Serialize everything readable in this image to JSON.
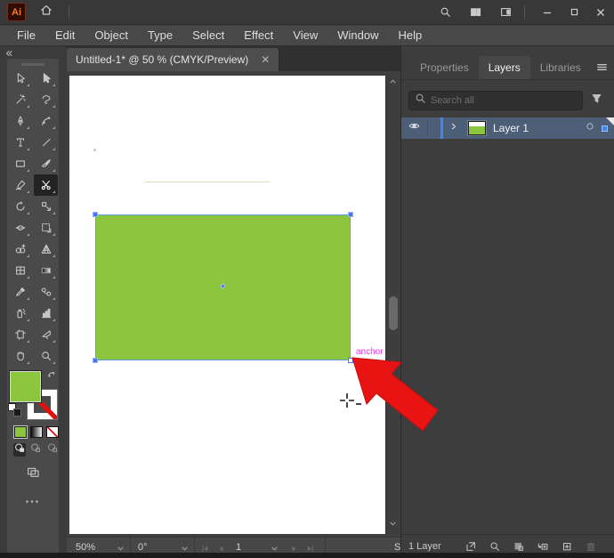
{
  "titlebar": {
    "app_badge": "Ai",
    "right_icons": [
      {
        "name": "search-icon",
        "icon": "search"
      },
      {
        "name": "workspace-switcher-icon",
        "icon": "workspace-grid"
      },
      {
        "name": "arrange-documents-icon",
        "icon": "arrange-doc"
      }
    ],
    "window_controls": [
      {
        "name": "minimize-button",
        "icon": "minimize"
      },
      {
        "name": "maximize-button",
        "icon": "maximize"
      },
      {
        "name": "close-button",
        "icon": "close"
      }
    ]
  },
  "menubar": {
    "items": [
      "File",
      "Edit",
      "Object",
      "Type",
      "Select",
      "Effect",
      "View",
      "Window",
      "Help"
    ]
  },
  "document_tab": {
    "title": "Untitled-1* @ 50 % (CMYK/Preview)",
    "close_glyph": "✕"
  },
  "toolbar": {
    "tools": [
      {
        "name": "selection-tool",
        "icon": "cursor-outline"
      },
      {
        "name": "direct-selection-tool",
        "icon": "cursor-filled"
      },
      {
        "name": "magic-wand-tool",
        "icon": "magic-wand"
      },
      {
        "name": "lasso-tool",
        "icon": "lasso"
      },
      {
        "name": "pen-tool",
        "icon": "pen"
      },
      {
        "name": "curvature-tool",
        "icon": "curvature"
      },
      {
        "name": "type-tool",
        "icon": "type"
      },
      {
        "name": "line-segment-tool",
        "icon": "line"
      },
      {
        "name": "rectangle-tool",
        "icon": "rectangle"
      },
      {
        "name": "paintbrush-tool",
        "icon": "paintbrush"
      },
      {
        "name": "shaper-tool",
        "icon": "shaper"
      },
      {
        "name": "scissors-tool",
        "icon": "scissors",
        "active": true
      },
      {
        "name": "rotate-tool",
        "icon": "rotate"
      },
      {
        "name": "scale-tool",
        "icon": "scale"
      },
      {
        "name": "width-tool",
        "icon": "width"
      },
      {
        "name": "free-transform-tool",
        "icon": "free-transform"
      },
      {
        "name": "shape-builder-tool",
        "icon": "shape-builder"
      },
      {
        "name": "perspective-grid-tool",
        "icon": "perspective-grid"
      },
      {
        "name": "mesh-tool",
        "icon": "mesh"
      },
      {
        "name": "gradient-tool",
        "icon": "gradient"
      },
      {
        "name": "eyedropper-tool",
        "icon": "eyedropper"
      },
      {
        "name": "blend-tool",
        "icon": "blend"
      },
      {
        "name": "symbol-sprayer-tool",
        "icon": "symbol-sprayer"
      },
      {
        "name": "graph-tool",
        "icon": "graph"
      },
      {
        "name": "artboard-tool",
        "icon": "artboard"
      },
      {
        "name": "slice-tool",
        "icon": "slice"
      },
      {
        "name": "hand-tool",
        "icon": "hand"
      },
      {
        "name": "zoom-tool",
        "icon": "zoom"
      }
    ],
    "fill_color": "#8CC63F",
    "more_label": "•••"
  },
  "canvas": {
    "anchor_label": "anchor"
  },
  "statusbar": {
    "zoom_level": "50%",
    "rotation": "0°",
    "artboard_number": "1",
    "tool_hint": "Sc"
  },
  "right_panel": {
    "tabs": [
      {
        "label": "Properties",
        "active": false
      },
      {
        "label": "Layers",
        "active": true
      },
      {
        "label": "Libraries",
        "active": false
      }
    ],
    "search_placeholder": "Search all",
    "layer_row": {
      "name": "Layer 1"
    },
    "footer": {
      "layer_count": "1 Layer",
      "icons": [
        {
          "name": "collect-for-export-icon",
          "icon": "collect-export"
        },
        {
          "name": "locate-object-icon",
          "icon": "locate-object"
        },
        {
          "name": "make-clipping-mask-icon",
          "icon": "clip-mask"
        },
        {
          "name": "create-sublayer-icon",
          "icon": "new-sublayer"
        },
        {
          "name": "create-new-layer-icon",
          "icon": "new-layer"
        },
        {
          "name": "delete-layer-icon",
          "icon": "trash",
          "disabled": true
        }
      ]
    }
  },
  "colors": {
    "rect_fill": "#8CC63F",
    "selection_blue": "#4A74F0",
    "layer_row_blue": "#4D5F77",
    "anchor_magenta": "#E937E9",
    "arrow_red": "#E81414"
  }
}
